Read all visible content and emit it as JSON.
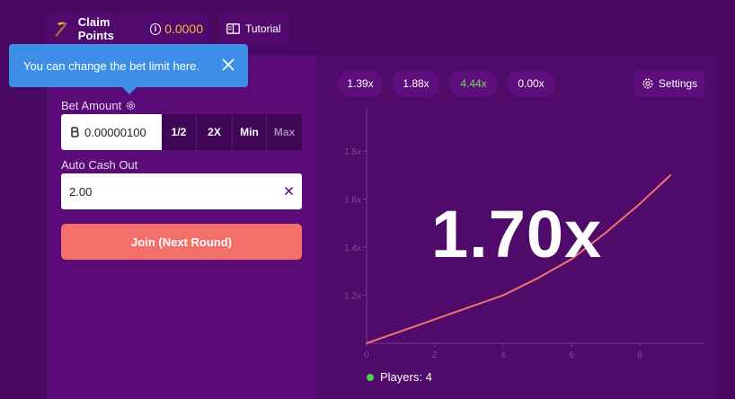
{
  "topbar": {
    "claim_label": "Claim Points",
    "claim_value": "0.0000",
    "tutorial_label": "Tutorial"
  },
  "tooltip": {
    "text": "You can change the bet limit here."
  },
  "bet": {
    "label": "Bet Amount",
    "value": "0.00000100",
    "buttons": {
      "half": "1/2",
      "double": "2X",
      "min": "Min",
      "max": "Max"
    }
  },
  "cashout": {
    "label": "Auto Cash Out",
    "value": "2.00"
  },
  "join_label": "Join (Next Round)",
  "history": [
    "1.39x",
    "1.88x",
    "4.44x",
    "0.00x"
  ],
  "settings_label": "Settings",
  "multiplier": "1.70x",
  "players_label": "Players: 4",
  "colors": {
    "accent": "#f26f6a",
    "tooltip": "#3c8ee6",
    "points": "#f5b83d",
    "highlight_history": "#7ed957",
    "online": "#4fd05a"
  },
  "chart_data": {
    "type": "line",
    "x_ticks": [
      "0",
      "2",
      "4",
      "6",
      "8"
    ],
    "y_ticks": [
      "1.2x",
      "1.4x",
      "1.6x",
      "1.8x"
    ],
    "xlim": [
      0,
      10
    ],
    "ylim": [
      1.0,
      1.98
    ],
    "series": [
      {
        "x": [
          0,
          1,
          2,
          3,
          4,
          5,
          6,
          7,
          8,
          8.9
        ],
        "y": [
          1.0,
          1.05,
          1.1,
          1.15,
          1.2,
          1.27,
          1.35,
          1.46,
          1.58,
          1.7
        ]
      }
    ]
  }
}
